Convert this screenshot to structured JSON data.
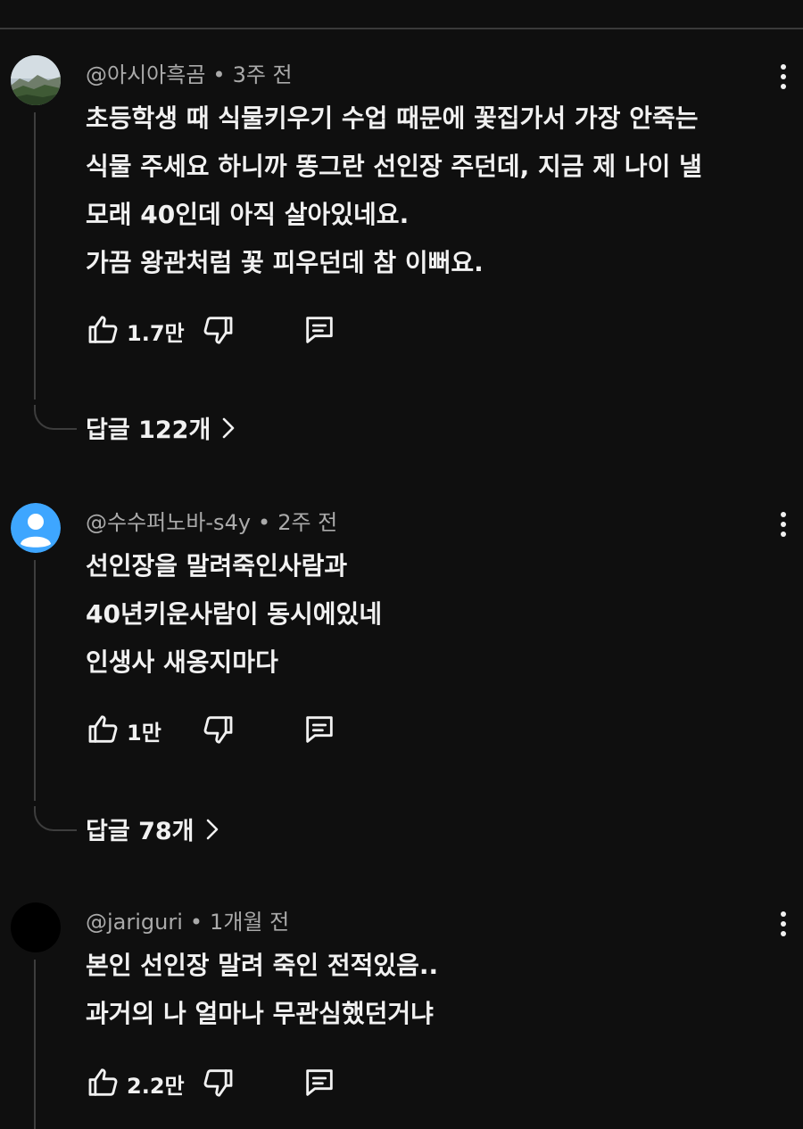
{
  "comments": [
    {
      "author": "@아시아흑곰",
      "separator": "•",
      "time": "3주 전",
      "lines": [
        "초등학생 때 식물키우기 수업 때문에 꽃집가서 가장 안죽는",
        "식물 주세요 하니까 똥그란 선인장 주던데, 지금 제 나이 낼",
        "모래 40인데 아직 살아있네요.",
        "가끔 왕관처럼 꽃 피우던데 참 이뻐요."
      ],
      "likes": "1.7만",
      "replies": "답글 122개",
      "avatar_icon": "landscape-avatar-icon"
    },
    {
      "author": "@수수퍼노바-s4y",
      "separator": "•",
      "time": "2주 전",
      "lines": [
        "선인장을 말려죽인사람과",
        "40년키운사람이 동시에있네",
        "인생사 새옹지마다"
      ],
      "likes": "1만",
      "replies": "답글 78개",
      "avatar_icon": "default-user-avatar-icon"
    },
    {
      "author": "@jariguri",
      "separator": "•",
      "time": "1개월 전",
      "lines": [
        "본인 선인장 말려 죽인 전적있음..",
        "과거의 나 얼마나 무관심했던거냐"
      ],
      "likes": "2.2만",
      "avatar_icon": "black-avatar-icon"
    }
  ],
  "icons": [
    "thumb-up-icon",
    "thumb-down-icon",
    "reply-icon",
    "more-vert-icon",
    "chevron-right-icon"
  ],
  "colors": {
    "background": "#0f0f0f",
    "text": "#f1f1f1",
    "meta": "#aaaaaa",
    "avatar_blue": "#3ea6ff"
  }
}
